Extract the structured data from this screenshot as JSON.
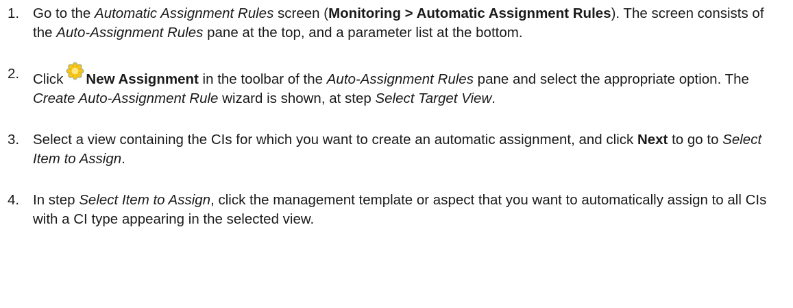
{
  "steps": [
    {
      "number": "1.",
      "parts": {
        "a": "Go to the ",
        "screen_name": "Automatic Assignment Rules",
        "b": " screen (",
        "menu_path": "Monitoring > Automatic Assignment Rules",
        "c": "). The screen consists of the ",
        "pane_name": "Auto-Assignment Rules",
        "d": " pane at the top, and a parameter list at the bottom."
      }
    },
    {
      "number": "2.",
      "parts": {
        "a": "Click",
        "icon": "new-assignment-icon",
        "button_name": "New Assignment",
        "b": " in the toolbar of the ",
        "pane_name": "Auto-Assignment Rules",
        "c": " pane and select the appropriate option. The ",
        "wizard_name": "Create Auto-Assignment Rule",
        "d": " wizard is shown, at step ",
        "step_name": "Select Target View",
        "e": "."
      }
    },
    {
      "number": "3.",
      "parts": {
        "a": "Select a view containing the CIs for which you want to create an automatic assignment, and click ",
        "button_name": "Next",
        "b": " to go to ",
        "step_name": "Select Item to Assign",
        "c": "."
      }
    },
    {
      "number": "4.",
      "parts": {
        "a": "In step ",
        "step_name": "Select Item to Assign",
        "b": ", click the management template or aspect that you want to automatically assign to all CIs with a CI type appearing in the selected view."
      }
    }
  ],
  "colors": {
    "text": "#1a1a1a",
    "icon_fill": "#f5c518",
    "icon_outline": "#9ec9e8"
  }
}
